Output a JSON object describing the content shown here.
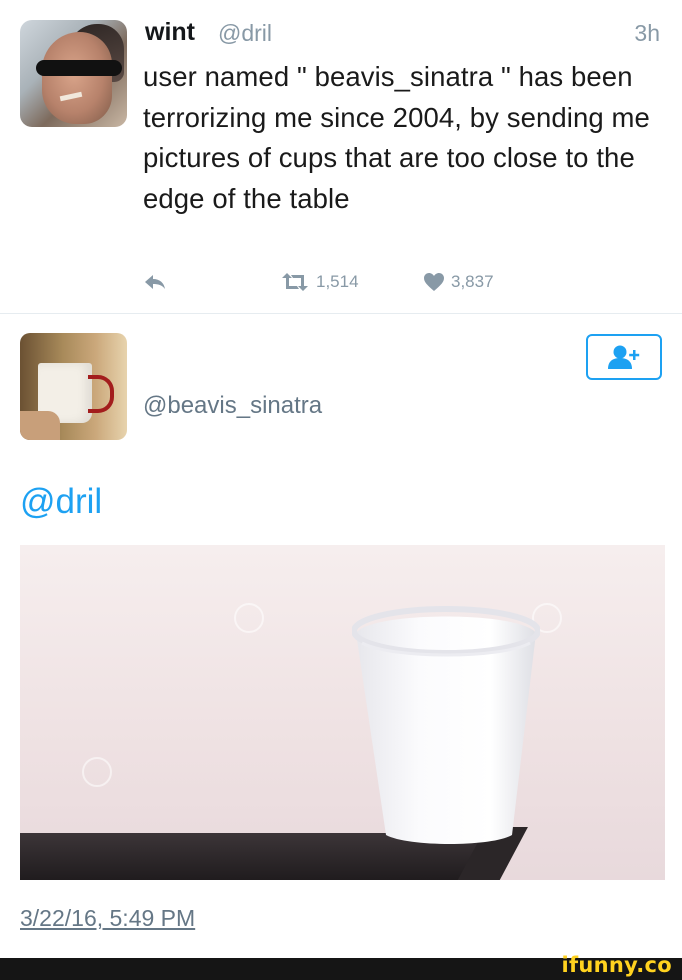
{
  "tweet": {
    "display_name": "wint",
    "handle": "@dril",
    "time_ago": "3h",
    "text": "user named \" beavis_sinatra \" has been terrorizing me since 2004, by sending me pictures of cups that are too close to the edge of the table",
    "retweets": "1,514",
    "likes": "3,837"
  },
  "profile_card": {
    "handle": "@beavis_sinatra"
  },
  "reply": {
    "mention": "@dril",
    "timestamp": "3/22/16, 5:49 PM"
  },
  "watermark": {
    "site": "ifunny.co"
  },
  "colors": {
    "accent": "#1da1f2",
    "muted": "#8899a6",
    "watermark": "#ffd21f"
  },
  "icons": [
    "reply-icon",
    "retweet-icon",
    "heart-icon",
    "follow-user-icon"
  ]
}
